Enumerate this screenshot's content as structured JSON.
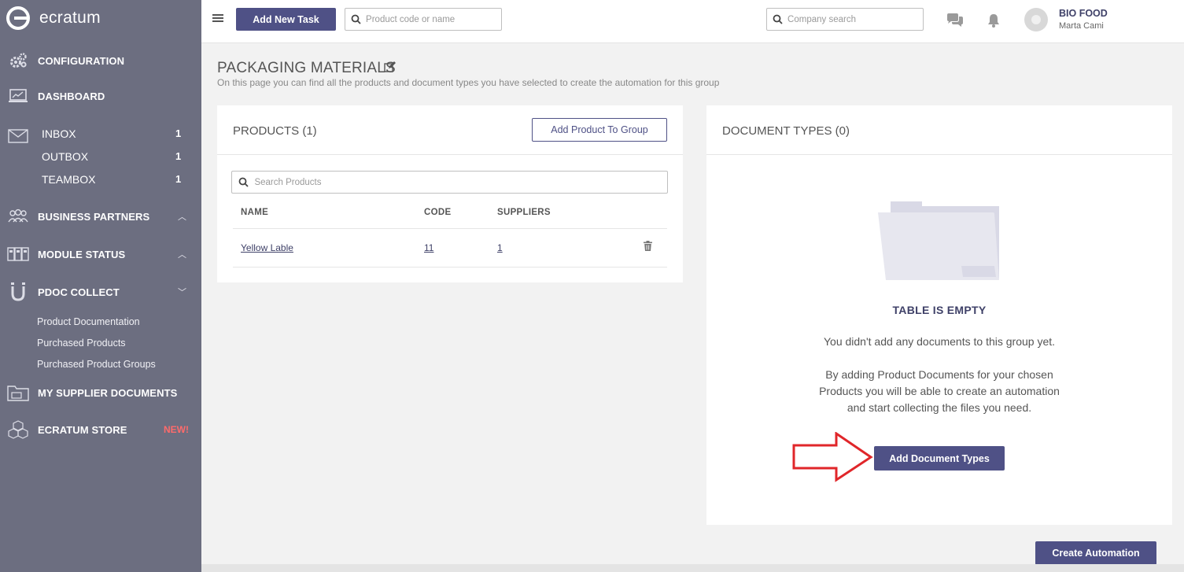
{
  "app": {
    "logo_text": "ecratum"
  },
  "sidebar": {
    "configuration": "CONFIGURATION",
    "dashboard": "DASHBOARD",
    "inbox": {
      "label": "INBOX",
      "count": "1"
    },
    "outbox": {
      "label": "OUTBOX",
      "count": "1"
    },
    "teambox": {
      "label": "TEAMBOX",
      "count": "1"
    },
    "business_partners": "BUSINESS PARTNERS",
    "module_status": "MODULE STATUS",
    "pdoc_collect": "PDOC COLLECT",
    "pdoc_links": [
      "Product Documentation",
      "Purchased Products",
      "Purchased Product Groups"
    ],
    "my_supplier_documents": "MY SUPPLIER DOCUMENTS",
    "ecratum_store": "ECRATUM STORE",
    "new_badge": "NEW!"
  },
  "topbar": {
    "add_task_label": "Add New Task",
    "product_search_placeholder": "Product code or name",
    "company_search_placeholder": "Company search",
    "company_name": "BIO FOOD",
    "user_name": "Marta Cami"
  },
  "page": {
    "title": "PACKAGING MATERIALS",
    "description": "On this page you can find all the products and document types you have selected to create the automation for this group"
  },
  "products": {
    "title": "PRODUCTS (1)",
    "add_button": "Add Product To Group",
    "search_placeholder": "Search Products",
    "columns": [
      "NAME",
      "CODE",
      "SUPPLIERS"
    ],
    "rows": [
      {
        "name": "Yellow Lable",
        "code": "11",
        "suppliers": "1"
      }
    ]
  },
  "document_types": {
    "title": "DOCUMENT TYPES (0)",
    "empty_title": "TABLE IS EMPTY",
    "empty_line1": "You didn't add any documents to this group yet.",
    "empty_line2": "By adding Product Documents for your chosen Products you will be able to create an automation and start collecting the files you need.",
    "add_button": "Add Document Types"
  },
  "footer": {
    "create_automation": "Create Automation"
  },
  "colors": {
    "sidebar": "#6c6e80",
    "primary": "#4f5186",
    "new_badge": "#ff6b6b",
    "arrow": "#e0262a"
  }
}
